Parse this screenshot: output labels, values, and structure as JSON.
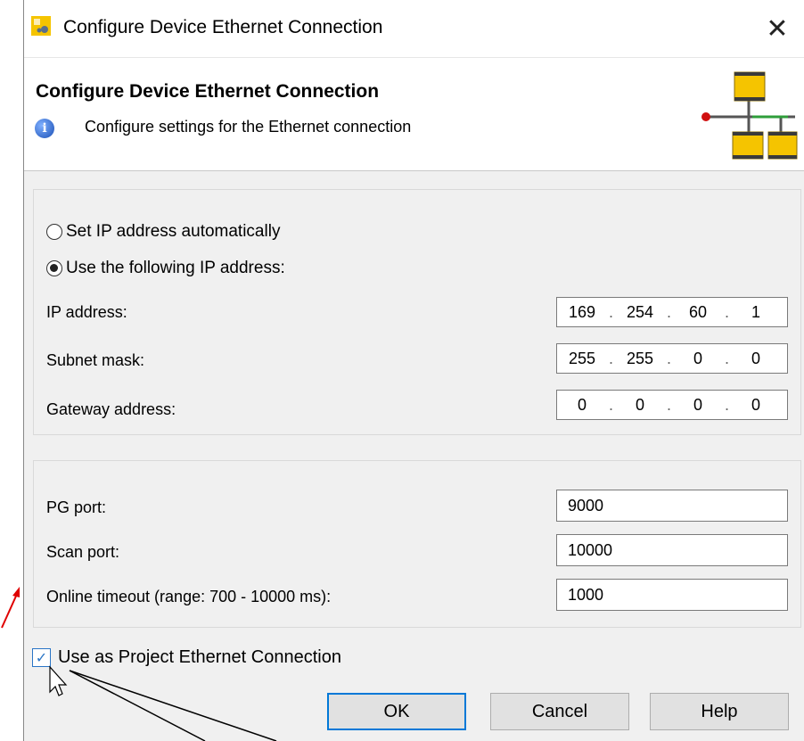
{
  "window": {
    "title": "Configure Device Ethernet Connection",
    "close_symbol": "✕"
  },
  "header": {
    "title": "Configure Device Ethernet Connection",
    "description": "Configure settings for the Ethernet connection",
    "info_icon_glyph": "i"
  },
  "ip_settings": {
    "auto_label": "Set IP address automatically",
    "manual_label": "Use the following IP address:",
    "selected": "manual",
    "ip_address": {
      "label": "IP address:",
      "octets": [
        "169",
        "254",
        "60",
        "1"
      ]
    },
    "subnet_mask": {
      "label": "Subnet mask:",
      "octets": [
        "255",
        "255",
        "0",
        "0"
      ]
    },
    "gateway": {
      "label": "Gateway address:",
      "octets": [
        "0",
        "0",
        "0",
        "0"
      ]
    }
  },
  "ports": {
    "pg_port": {
      "label": "PG port:",
      "value": "9000"
    },
    "scan_port": {
      "label": "Scan port:",
      "value": "10000"
    },
    "timeout": {
      "label": "Online timeout (range: 700 - 10000 ms):",
      "value": "1000"
    }
  },
  "project_connection": {
    "label": "Use as Project Ethernet Connection",
    "checked": true,
    "check_glyph": "✓"
  },
  "buttons": {
    "ok": "OK",
    "cancel": "Cancel",
    "help": "Help"
  },
  "colors": {
    "accent": "#0078d7",
    "annotation_arrow": "#e00000",
    "device_yellow": "#f5c400"
  }
}
